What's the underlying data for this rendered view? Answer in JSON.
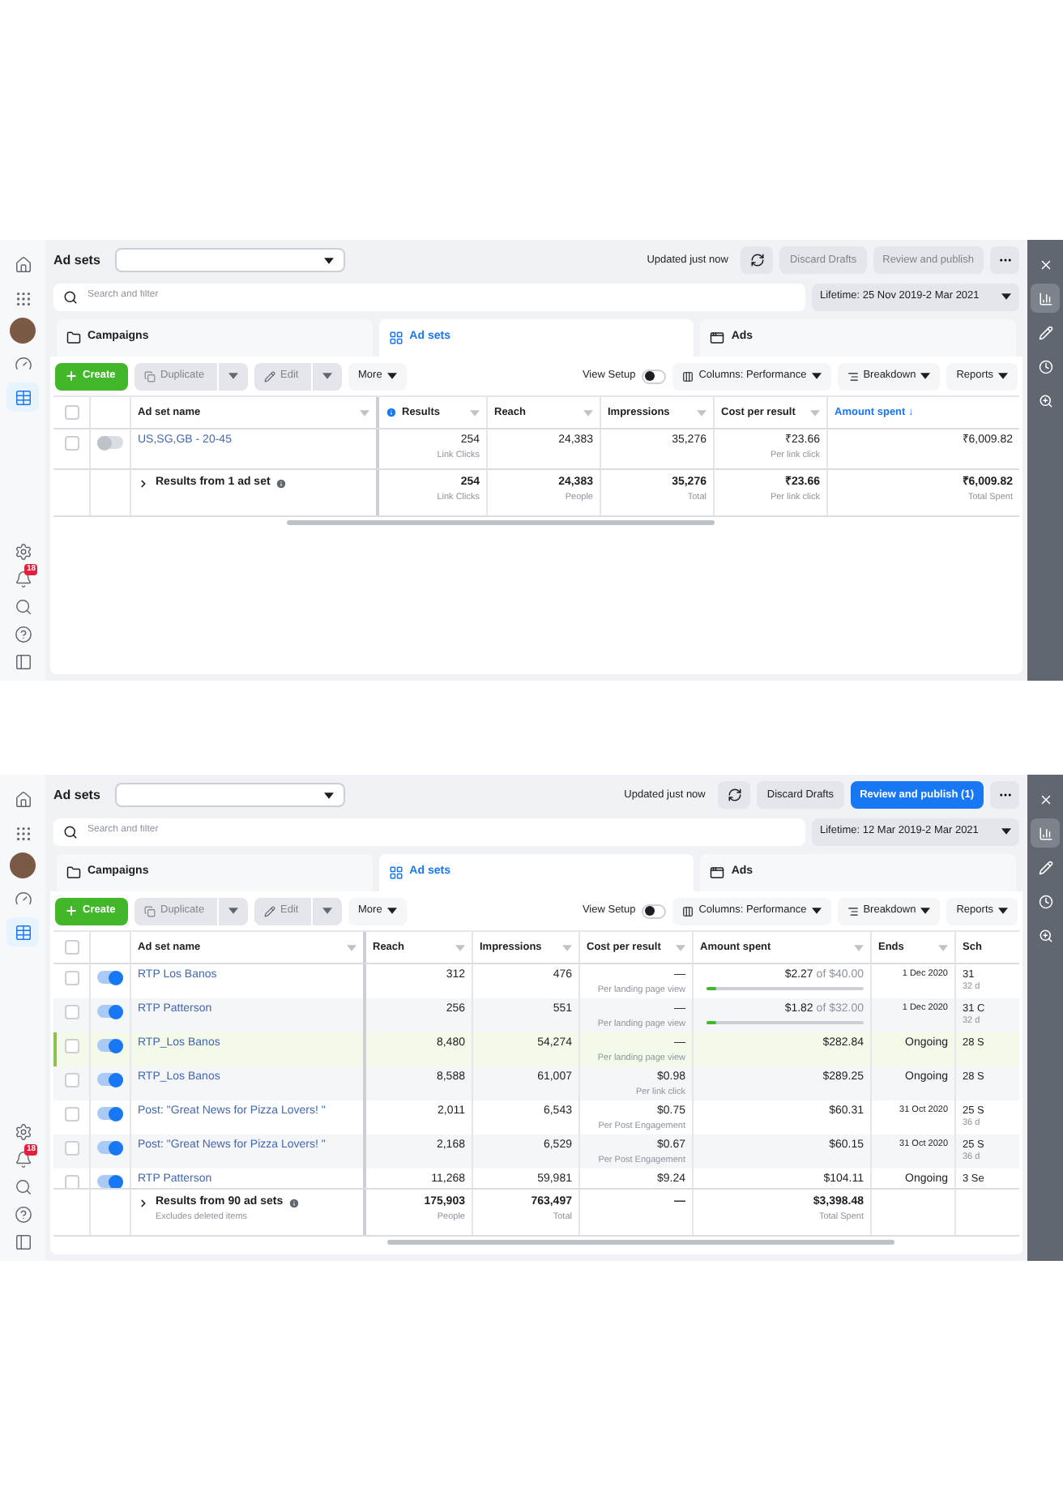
{
  "screens": [
    {
      "title": "Ad sets",
      "status": "Updated just now",
      "discard": {
        "label": "Discard Drafts",
        "disabled": true
      },
      "publish": {
        "label": "Review and publish",
        "disabled": true
      },
      "search": {
        "placeholder": "Search and filter"
      },
      "date_range": "Lifetime: 25 Nov 2019-2 Mar 2021",
      "nav_top": [
        {
          "kind": "home",
          "selected": false
        },
        {
          "kind": "apps",
          "selected": false
        },
        {
          "kind": "avatar",
          "selected": false
        },
        {
          "kind": "gauge",
          "selected": false
        },
        {
          "kind": "table",
          "selected": true
        }
      ],
      "nav_bottom": [
        {
          "kind": "settings",
          "selected": false
        },
        {
          "kind": "bell",
          "selected": false,
          "badge": "18"
        },
        {
          "kind": "search",
          "selected": false
        },
        {
          "kind": "help",
          "selected": false
        },
        {
          "kind": "panel",
          "selected": false
        }
      ],
      "tools": [
        {
          "kind": "close",
          "selected": false
        },
        {
          "kind": "chart",
          "selected": true
        },
        {
          "kind": "edit",
          "selected": false
        },
        {
          "kind": "history",
          "selected": false
        },
        {
          "kind": "zoom",
          "selected": false
        }
      ],
      "tabs": [
        {
          "kind": "campaigns",
          "label": "Campaigns",
          "selected": false
        },
        {
          "kind": "adsets",
          "label": "Ad sets",
          "selected": true
        },
        {
          "kind": "ads",
          "label": "Ads",
          "selected": false
        }
      ],
      "toolbar": {
        "create": "Create",
        "duplicate": {
          "label": "Duplicate",
          "disabled": true
        },
        "edit": {
          "label": "Edit",
          "disabled": true
        },
        "more": "More",
        "view_setup": {
          "label": "View Setup",
          "on": false
        },
        "columns": "Columns: Performance",
        "breakdown": "Breakdown",
        "reports": "Reports"
      },
      "table": {
        "select_all": false,
        "columns": [
          {
            "label": "Ad set name",
            "info": false,
            "sorted": false
          },
          {
            "label": "Results",
            "info": true,
            "sorted": false
          },
          {
            "label": "Reach",
            "info": false,
            "sorted": false
          },
          {
            "label": "Impressions",
            "info": false,
            "sorted": false
          },
          {
            "label": "Cost per result",
            "info": false,
            "sorted": false
          },
          {
            "label": "Amount spent ↓",
            "info": false,
            "sorted": true
          }
        ],
        "rows": [
          {
            "checked": false,
            "on": false,
            "highlighted": false,
            "cells": [
              {
                "value": "US,SG,GB - 20-45"
              },
              {
                "value": "254",
                "sub": "Link Clicks"
              },
              {
                "value": "24,383"
              },
              {
                "value": "35,276"
              },
              {
                "value": "₹23.66",
                "sub": "Per link click"
              },
              {
                "value": "₹6,009.82"
              }
            ]
          }
        ],
        "totals": {
          "cells": [
            {
              "value": "Results from 1 ad set"
            },
            {
              "value": "254",
              "sub": "Link Clicks"
            },
            {
              "value": "24,383",
              "sub": "People"
            },
            {
              "value": "35,276",
              "sub": "Total"
            },
            {
              "value": "₹23.66",
              "sub": "Per link click"
            },
            {
              "value": "₹6,009.82",
              "sub": "Total Spent"
            }
          ]
        }
      }
    },
    {
      "title": "Ad sets",
      "status": "Updated just now",
      "discard": {
        "label": "Discard Drafts",
        "disabled": false
      },
      "publish": {
        "label": "Review and publish (1)",
        "disabled": false
      },
      "search": {
        "placeholder": "Search and filter"
      },
      "date_range": "Lifetime: 12 Mar 2019-2 Mar 2021",
      "nav_top": [
        {
          "kind": "home",
          "selected": false
        },
        {
          "kind": "apps",
          "selected": false
        },
        {
          "kind": "avatar",
          "selected": false
        },
        {
          "kind": "gauge",
          "selected": false
        },
        {
          "kind": "table",
          "selected": true
        }
      ],
      "nav_bottom": [
        {
          "kind": "settings",
          "selected": false
        },
        {
          "kind": "bell",
          "selected": false,
          "badge": "18"
        },
        {
          "kind": "search",
          "selected": false
        },
        {
          "kind": "help",
          "selected": false
        },
        {
          "kind": "panel",
          "selected": false
        }
      ],
      "tools": [
        {
          "kind": "close",
          "selected": false
        },
        {
          "kind": "chart",
          "selected": true
        },
        {
          "kind": "edit",
          "selected": false
        },
        {
          "kind": "history",
          "selected": false
        },
        {
          "kind": "zoom",
          "selected": false
        }
      ],
      "tabs": [
        {
          "kind": "campaigns",
          "label": "Campaigns",
          "selected": false
        },
        {
          "kind": "adsets",
          "label": "Ad sets",
          "selected": true
        },
        {
          "kind": "ads",
          "label": "Ads",
          "selected": false
        }
      ],
      "toolbar": {
        "create": "Create",
        "duplicate": {
          "label": "Duplicate",
          "disabled": true
        },
        "edit": {
          "label": "Edit",
          "disabled": true
        },
        "more": "More",
        "view_setup": {
          "label": "View Setup",
          "on": false
        },
        "columns": "Columns: Performance",
        "breakdown": "Breakdown",
        "reports": "Reports"
      },
      "table": {
        "select_all": false,
        "columns": [
          {
            "label": "Ad set name",
            "info": false,
            "sorted": false
          },
          {
            "label": "Reach",
            "info": false,
            "sorted": false
          },
          {
            "label": "Impressions",
            "info": false,
            "sorted": false
          },
          {
            "label": "Cost per result",
            "info": false,
            "sorted": false
          },
          {
            "label": "Amount spent",
            "info": false,
            "sorted": false
          },
          {
            "label": "Ends",
            "info": false,
            "sorted": false
          },
          {
            "label": "Sch",
            "info": false,
            "sorted": false
          }
        ],
        "rows": [
          {
            "checked": false,
            "on": true,
            "highlighted": false,
            "cells": [
              {
                "value": "RTP Los Banos"
              },
              {
                "value": "312"
              },
              {
                "value": "476"
              },
              {
                "value": "—",
                "sub": "Per landing page view"
              },
              {
                "value": "$2.27",
                "budget": "of $40.00",
                "level": 0.06
              },
              {
                "value": "1 Dec 2020",
                "kind": "date"
              },
              {
                "value": "31",
                "sub": "32 d"
              }
            ]
          },
          {
            "checked": false,
            "on": true,
            "highlighted": false,
            "cells": [
              {
                "value": "RTP Patterson"
              },
              {
                "value": "256"
              },
              {
                "value": "551"
              },
              {
                "value": "—",
                "sub": "Per landing page view"
              },
              {
                "value": "$1.82",
                "budget": "of $32.00",
                "level": 0.06
              },
              {
                "value": "1 Dec 2020",
                "kind": "date"
              },
              {
                "value": "31 C",
                "sub": "32 d"
              }
            ]
          },
          {
            "checked": false,
            "on": true,
            "highlighted": true,
            "cells": [
              {
                "value": "RTP_Los Banos"
              },
              {
                "value": "8,480"
              },
              {
                "value": "54,274"
              },
              {
                "value": "—",
                "sub": "Per landing page view"
              },
              {
                "value": "$282.84"
              },
              {
                "value": "Ongoing"
              },
              {
                "value": "28 S"
              }
            ]
          },
          {
            "checked": false,
            "on": true,
            "highlighted": false,
            "cells": [
              {
                "value": "RTP_Los Banos"
              },
              {
                "value": "8,588"
              },
              {
                "value": "61,007"
              },
              {
                "value": "$0.98",
                "sub": "Per link click"
              },
              {
                "value": "$289.25"
              },
              {
                "value": "Ongoing"
              },
              {
                "value": "28 S"
              }
            ]
          },
          {
            "checked": false,
            "on": true,
            "highlighted": false,
            "cells": [
              {
                "value": "Post: \"Great News for Pizza Lovers! \""
              },
              {
                "value": "2,011"
              },
              {
                "value": "6,543"
              },
              {
                "value": "$0.75",
                "sub": "Per Post Engagement"
              },
              {
                "value": "$60.31"
              },
              {
                "value": "31 Oct 2020",
                "kind": "date"
              },
              {
                "value": "25 S",
                "sub": "36 d"
              }
            ]
          },
          {
            "checked": false,
            "on": true,
            "highlighted": false,
            "cells": [
              {
                "value": "Post: \"Great News for Pizza Lovers! \""
              },
              {
                "value": "2,168"
              },
              {
                "value": "6,529"
              },
              {
                "value": "$0.67",
                "sub": "Per Post Engagement"
              },
              {
                "value": "$60.15"
              },
              {
                "value": "31 Oct 2020",
                "kind": "date"
              },
              {
                "value": "25 S",
                "sub": "36 d"
              }
            ]
          },
          {
            "checked": false,
            "on": true,
            "highlighted": false,
            "cells": [
              {
                "value": "RTP Patterson"
              },
              {
                "value": "11,268"
              },
              {
                "value": "59,981"
              },
              {
                "value": "$9.24"
              },
              {
                "value": "$104.11"
              },
              {
                "value": "Ongoing"
              },
              {
                "value": "3 Se"
              }
            ]
          }
        ],
        "totals": {
          "cells": [
            {
              "value": "Results from 90 ad sets",
              "sub": "Excludes deleted items"
            },
            {
              "value": "175,903",
              "sub": "People"
            },
            {
              "value": "763,497",
              "sub": "Total"
            },
            {
              "value": "—"
            },
            {
              "value": "$3,398.48",
              "sub": "Total Spent"
            },
            null,
            null
          ]
        }
      }
    }
  ]
}
